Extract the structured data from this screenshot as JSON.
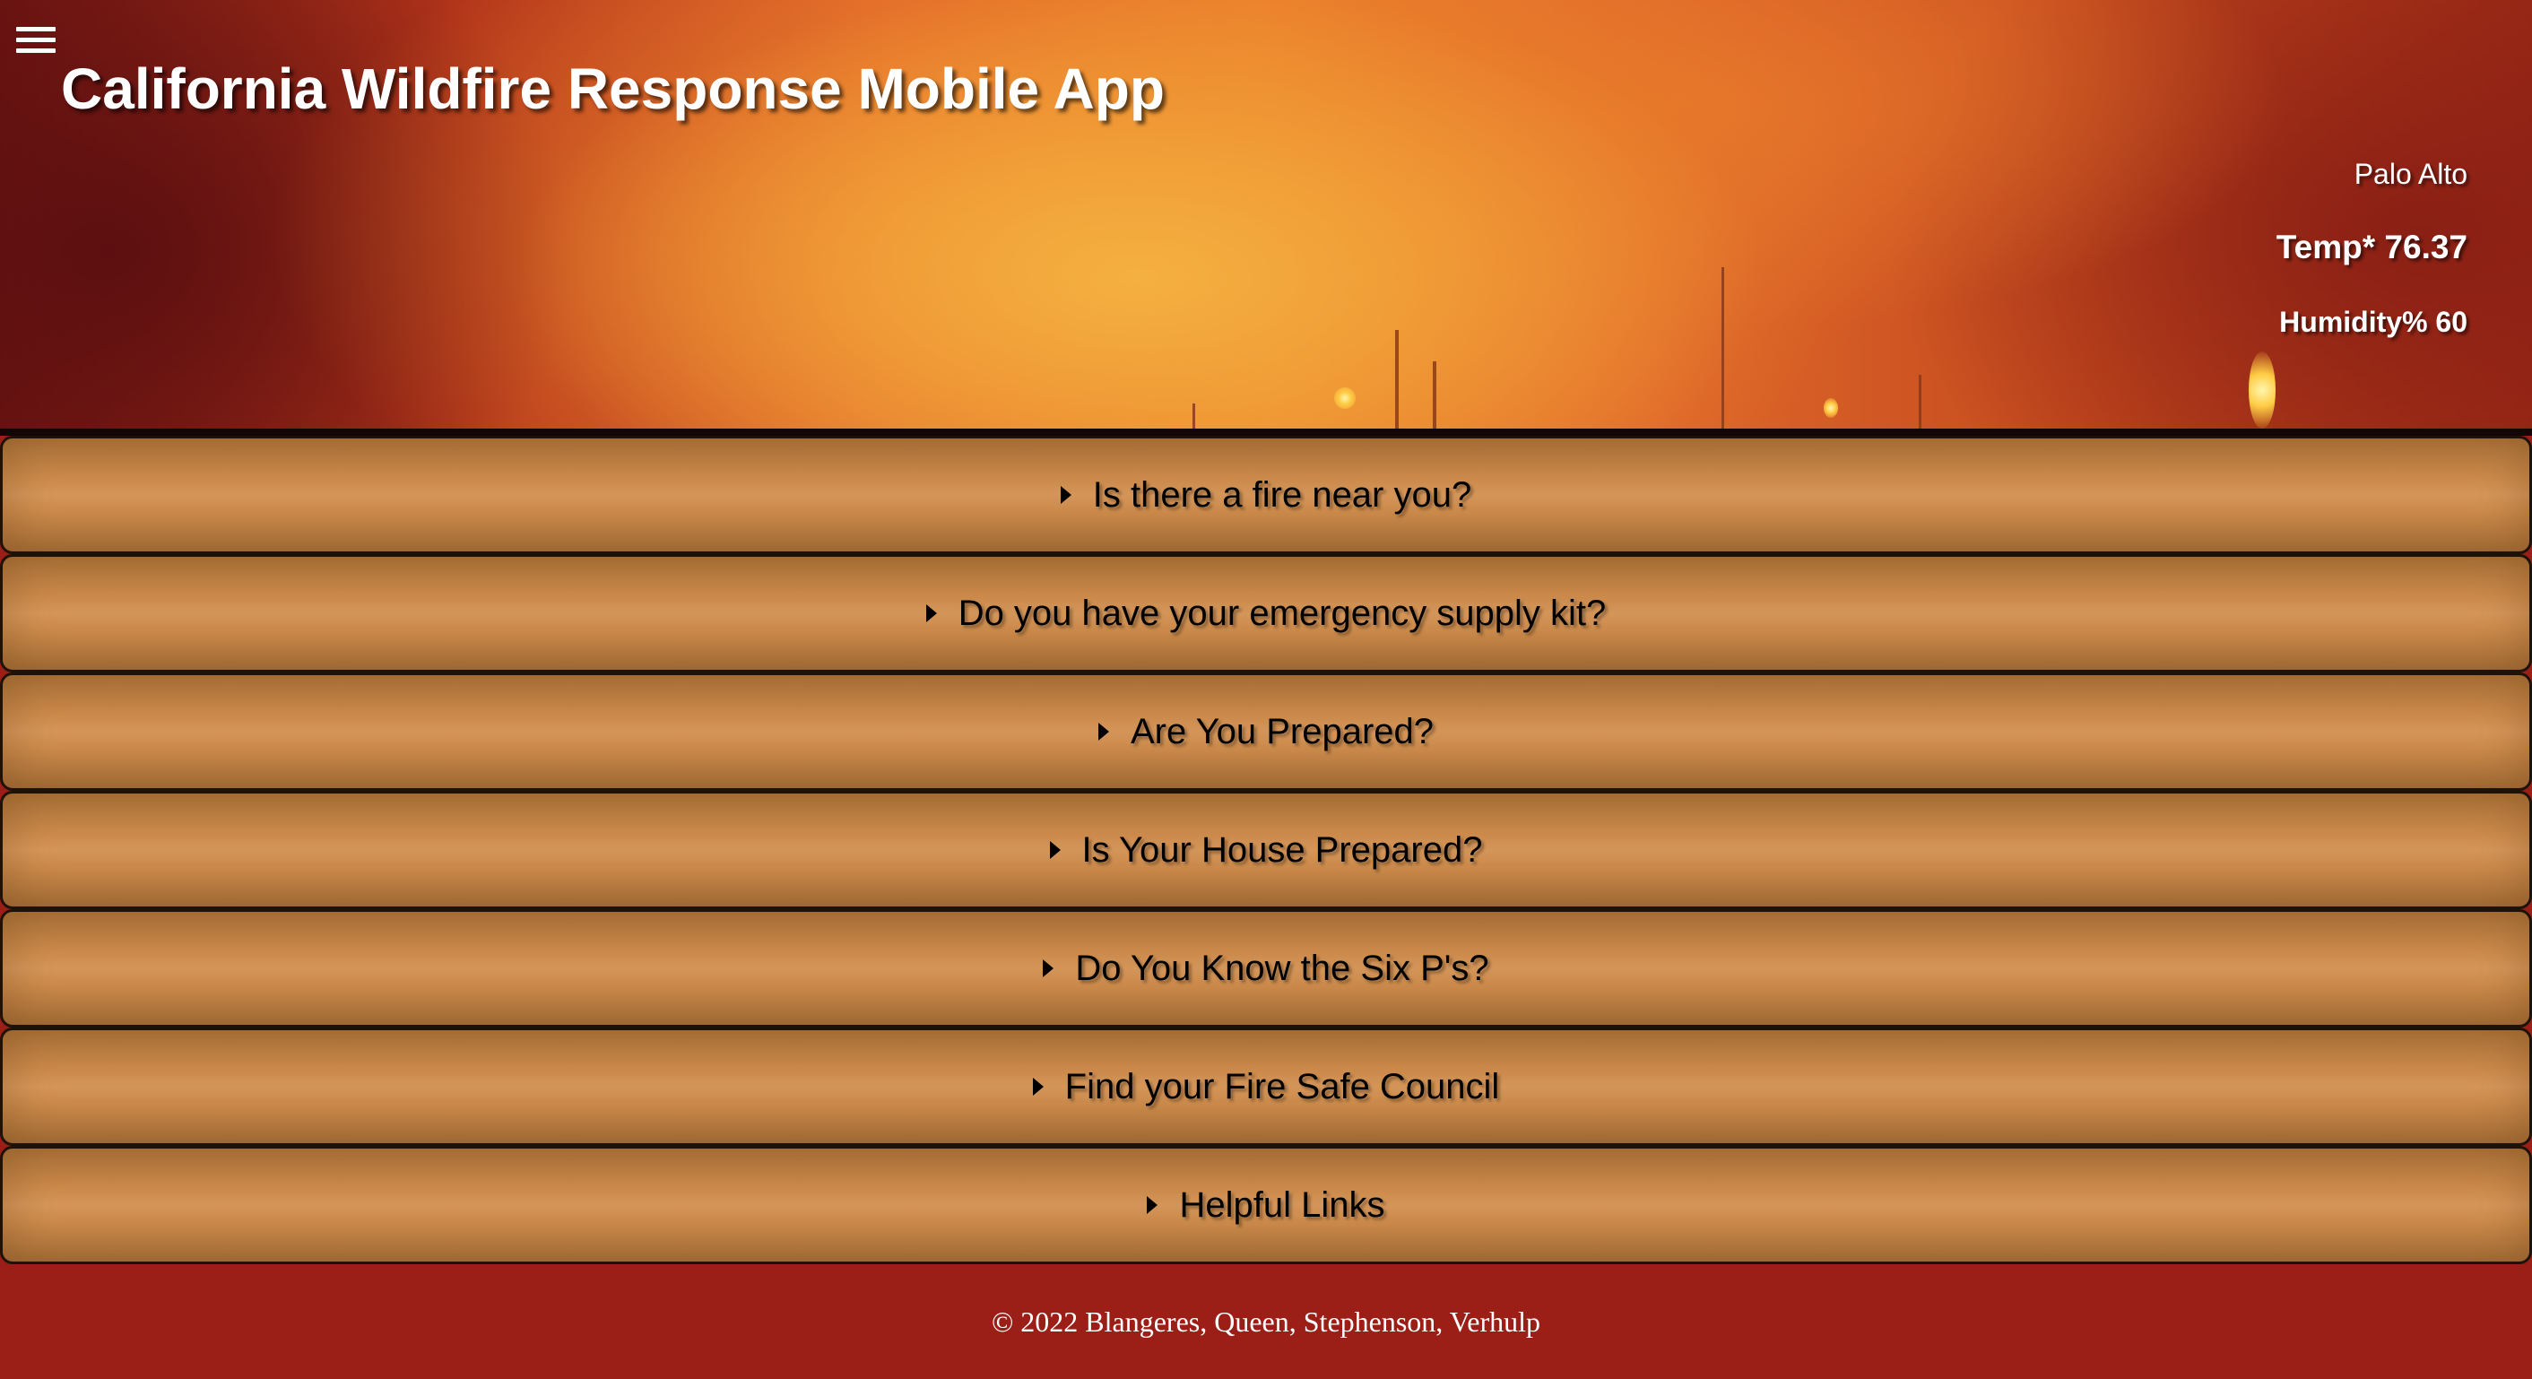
{
  "header": {
    "title": "California Wildfire Response Mobile App",
    "menu_icon": "hamburger-menu-icon"
  },
  "weather": {
    "city": "Palo Alto",
    "temp": "Temp* 76.37",
    "humidity": "Humidity% 60"
  },
  "accordion": {
    "items": [
      {
        "label": "Is there a fire near you?"
      },
      {
        "label": "Do you have your emergency supply kit?"
      },
      {
        "label": "Are You Prepared?"
      },
      {
        "label": "Is Your House Prepared?"
      },
      {
        "label": "Do You Know the Six P's?"
      },
      {
        "label": "Find your Fire Safe Council"
      },
      {
        "label": "Helpful Links"
      }
    ]
  },
  "footer": {
    "copyright": "© 2022 Blangeres, Queen, Stephenson, Verhulp"
  },
  "colors": {
    "footer_bg": "#9c1f17",
    "accordion_bg": "#cd8c4c",
    "header_fire": "#ea7f2c"
  }
}
